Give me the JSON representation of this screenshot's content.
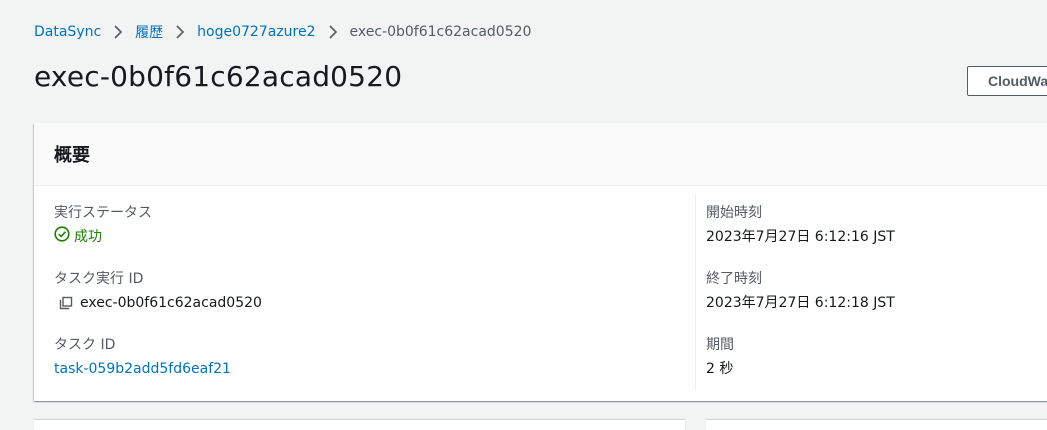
{
  "breadcrumb": {
    "items": [
      {
        "label": "DataSync"
      },
      {
        "label": "履歴"
      },
      {
        "label": "hoge0727azure2"
      }
    ],
    "current": "exec-0b0f61c62acad0520"
  },
  "page": {
    "title": "exec-0b0f61c62acad0520"
  },
  "header_actions": {
    "cloudwatch_label": "CloudWatch"
  },
  "summary": {
    "title": "概要",
    "left": {
      "status_label": "実行ステータス",
      "status_value": "成功",
      "exec_id_label": "タスク実行 ID",
      "exec_id_value": "exec-0b0f61c62acad0520",
      "task_id_label": "タスク ID",
      "task_id_value": "task-059b2add5fd6eaf21"
    },
    "right": {
      "start_label": "開始時刻",
      "start_value": "2023年7月27日 6:12:16 JST",
      "end_label": "終了時刻",
      "end_value": "2023年7月27日 6:12:18 JST",
      "duration_label": "期間",
      "duration_value": "2 秒"
    }
  },
  "icons": {
    "status": "success-check-circle-icon",
    "copy": "copy-icon",
    "separator": "chevron-right-icon"
  },
  "colors": {
    "link": "#0073bb",
    "success": "#1d8102",
    "background": "#f2f3f3",
    "text": "#16191f",
    "secondary_text": "#545b64"
  }
}
